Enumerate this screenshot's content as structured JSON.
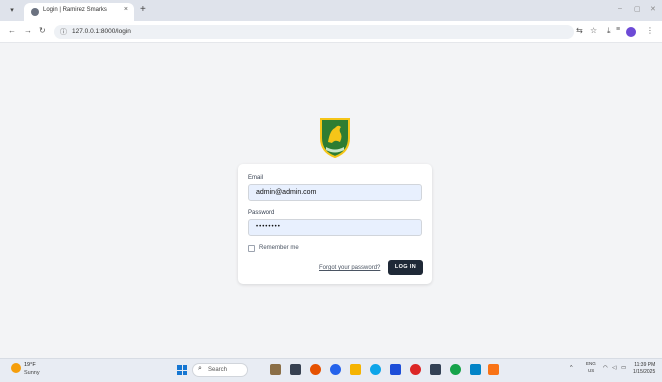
{
  "browser": {
    "tab_title": "Login | Ramirez Smarks",
    "tab_close": "×",
    "new_tab": "+",
    "url": "127.0.0.1:8000/login",
    "window_controls": [
      "–",
      "▢",
      "✕"
    ]
  },
  "login": {
    "email_label": "Email",
    "email_value": "admin@admin.com",
    "password_label": "Password",
    "password_value": "••••••••",
    "remember_label": "Remember me",
    "forgot_label": "Forgot your password?",
    "login_button": "LOG IN"
  },
  "taskbar": {
    "weather_temp": "19°F",
    "weather_desc": "Sunny",
    "search_placeholder": "Search",
    "lang_top": "ENG",
    "lang_bottom": "US",
    "time": "11:39 PM",
    "date": "1/15/2025"
  },
  "colors": {
    "page_bg": "#f3f4f6",
    "button_bg": "#1f2937",
    "input_bg": "#e8f0fe",
    "logo_green": "#2e7d32",
    "logo_yellow": "#f5c518"
  }
}
